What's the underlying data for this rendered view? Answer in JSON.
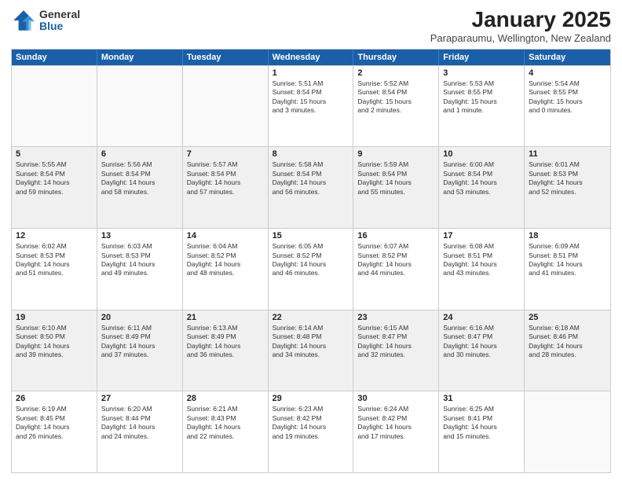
{
  "logo": {
    "general": "General",
    "blue": "Blue"
  },
  "header": {
    "month": "January 2025",
    "location": "Paraparaumu, Wellington, New Zealand"
  },
  "days": [
    "Sunday",
    "Monday",
    "Tuesday",
    "Wednesday",
    "Thursday",
    "Friday",
    "Saturday"
  ],
  "weeks": [
    [
      {
        "day": "",
        "info": ""
      },
      {
        "day": "",
        "info": ""
      },
      {
        "day": "",
        "info": ""
      },
      {
        "day": "1",
        "info": "Sunrise: 5:51 AM\nSunset: 8:54 PM\nDaylight: 15 hours\nand 3 minutes."
      },
      {
        "day": "2",
        "info": "Sunrise: 5:52 AM\nSunset: 8:54 PM\nDaylight: 15 hours\nand 2 minutes."
      },
      {
        "day": "3",
        "info": "Sunrise: 5:53 AM\nSunset: 8:55 PM\nDaylight: 15 hours\nand 1 minute."
      },
      {
        "day": "4",
        "info": "Sunrise: 5:54 AM\nSunset: 8:55 PM\nDaylight: 15 hours\nand 0 minutes."
      }
    ],
    [
      {
        "day": "5",
        "info": "Sunrise: 5:55 AM\nSunset: 8:54 PM\nDaylight: 14 hours\nand 59 minutes."
      },
      {
        "day": "6",
        "info": "Sunrise: 5:56 AM\nSunset: 8:54 PM\nDaylight: 14 hours\nand 58 minutes."
      },
      {
        "day": "7",
        "info": "Sunrise: 5:57 AM\nSunset: 8:54 PM\nDaylight: 14 hours\nand 57 minutes."
      },
      {
        "day": "8",
        "info": "Sunrise: 5:58 AM\nSunset: 8:54 PM\nDaylight: 14 hours\nand 56 minutes."
      },
      {
        "day": "9",
        "info": "Sunrise: 5:59 AM\nSunset: 8:54 PM\nDaylight: 14 hours\nand 55 minutes."
      },
      {
        "day": "10",
        "info": "Sunrise: 6:00 AM\nSunset: 8:54 PM\nDaylight: 14 hours\nand 53 minutes."
      },
      {
        "day": "11",
        "info": "Sunrise: 6:01 AM\nSunset: 8:53 PM\nDaylight: 14 hours\nand 52 minutes."
      }
    ],
    [
      {
        "day": "12",
        "info": "Sunrise: 6:02 AM\nSunset: 8:53 PM\nDaylight: 14 hours\nand 51 minutes."
      },
      {
        "day": "13",
        "info": "Sunrise: 6:03 AM\nSunset: 8:53 PM\nDaylight: 14 hours\nand 49 minutes."
      },
      {
        "day": "14",
        "info": "Sunrise: 6:04 AM\nSunset: 8:52 PM\nDaylight: 14 hours\nand 48 minutes."
      },
      {
        "day": "15",
        "info": "Sunrise: 6:05 AM\nSunset: 8:52 PM\nDaylight: 14 hours\nand 46 minutes."
      },
      {
        "day": "16",
        "info": "Sunrise: 6:07 AM\nSunset: 8:52 PM\nDaylight: 14 hours\nand 44 minutes."
      },
      {
        "day": "17",
        "info": "Sunrise: 6:08 AM\nSunset: 8:51 PM\nDaylight: 14 hours\nand 43 minutes."
      },
      {
        "day": "18",
        "info": "Sunrise: 6:09 AM\nSunset: 8:51 PM\nDaylight: 14 hours\nand 41 minutes."
      }
    ],
    [
      {
        "day": "19",
        "info": "Sunrise: 6:10 AM\nSunset: 8:50 PM\nDaylight: 14 hours\nand 39 minutes."
      },
      {
        "day": "20",
        "info": "Sunrise: 6:11 AM\nSunset: 8:49 PM\nDaylight: 14 hours\nand 37 minutes."
      },
      {
        "day": "21",
        "info": "Sunrise: 6:13 AM\nSunset: 8:49 PM\nDaylight: 14 hours\nand 36 minutes."
      },
      {
        "day": "22",
        "info": "Sunrise: 6:14 AM\nSunset: 8:48 PM\nDaylight: 14 hours\nand 34 minutes."
      },
      {
        "day": "23",
        "info": "Sunrise: 6:15 AM\nSunset: 8:47 PM\nDaylight: 14 hours\nand 32 minutes."
      },
      {
        "day": "24",
        "info": "Sunrise: 6:16 AM\nSunset: 8:47 PM\nDaylight: 14 hours\nand 30 minutes."
      },
      {
        "day": "25",
        "info": "Sunrise: 6:18 AM\nSunset: 8:46 PM\nDaylight: 14 hours\nand 28 minutes."
      }
    ],
    [
      {
        "day": "26",
        "info": "Sunrise: 6:19 AM\nSunset: 8:45 PM\nDaylight: 14 hours\nand 26 minutes."
      },
      {
        "day": "27",
        "info": "Sunrise: 6:20 AM\nSunset: 8:44 PM\nDaylight: 14 hours\nand 24 minutes."
      },
      {
        "day": "28",
        "info": "Sunrise: 6:21 AM\nSunset: 8:43 PM\nDaylight: 14 hours\nand 22 minutes."
      },
      {
        "day": "29",
        "info": "Sunrise: 6:23 AM\nSunset: 8:42 PM\nDaylight: 14 hours\nand 19 minutes."
      },
      {
        "day": "30",
        "info": "Sunrise: 6:24 AM\nSunset: 8:42 PM\nDaylight: 14 hours\nand 17 minutes."
      },
      {
        "day": "31",
        "info": "Sunrise: 6:25 AM\nSunset: 8:41 PM\nDaylight: 14 hours\nand 15 minutes."
      },
      {
        "day": "",
        "info": ""
      }
    ]
  ]
}
